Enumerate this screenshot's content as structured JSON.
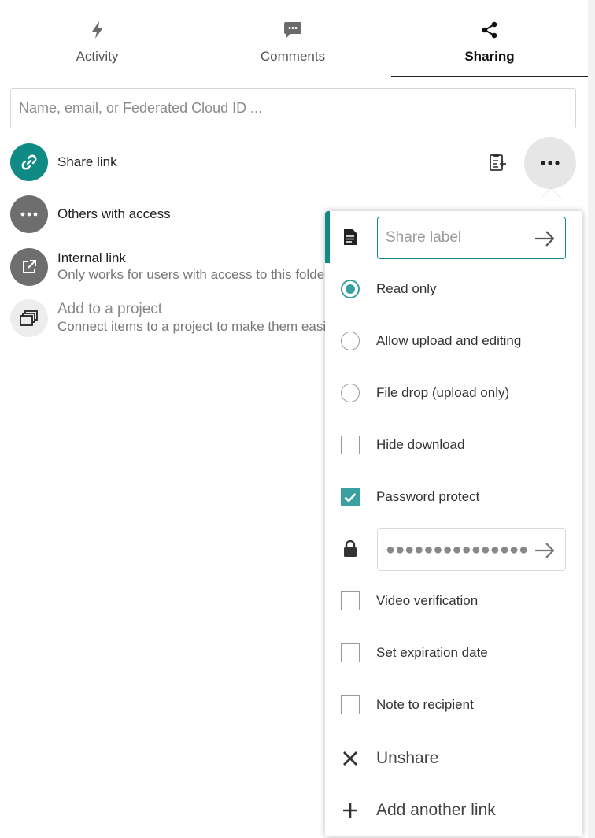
{
  "tabs": [
    {
      "label": "Activity",
      "icon": "bolt-icon",
      "active": false
    },
    {
      "label": "Comments",
      "icon": "comment-icon",
      "active": false
    },
    {
      "label": "Sharing",
      "icon": "share-icon",
      "active": true
    }
  ],
  "search": {
    "placeholder": "Name, email, or Federated Cloud ID ..."
  },
  "share_list": {
    "share_link": {
      "title": "Share link",
      "icon": "link-icon"
    },
    "others": {
      "title": "Others with access",
      "icon": "dots-icon"
    },
    "internal": {
      "title": "Internal link",
      "subtitle": "Only works for users with access to this folder",
      "icon": "external-link-icon"
    },
    "project": {
      "title": "Add to a project",
      "subtitle": "Connect items to a project to make them easier to find",
      "icon": "project-icon"
    }
  },
  "menu": {
    "label_placeholder": "Share label",
    "permissions": [
      {
        "label": "Read only",
        "checked": true
      },
      {
        "label": "Allow upload and editing",
        "checked": false
      },
      {
        "label": "File drop (upload only)",
        "checked": false
      }
    ],
    "hide_download": {
      "label": "Hide download",
      "checked": false
    },
    "password_protect": {
      "label": "Password protect",
      "checked": true
    },
    "password_mask": "●●●●●●●●●●●●●●●",
    "video_verification": {
      "label": "Video verification",
      "checked": false
    },
    "expiration": {
      "label": "Set expiration date",
      "checked": false
    },
    "note": {
      "label": "Note to recipient",
      "checked": false
    },
    "unshare": {
      "label": "Unshare"
    },
    "add_link": {
      "label": "Add another link"
    }
  },
  "colors": {
    "accent": "#0f8a84",
    "radio_checked": "#3aa1a0",
    "avatar_gray": "#6e6e6e"
  }
}
